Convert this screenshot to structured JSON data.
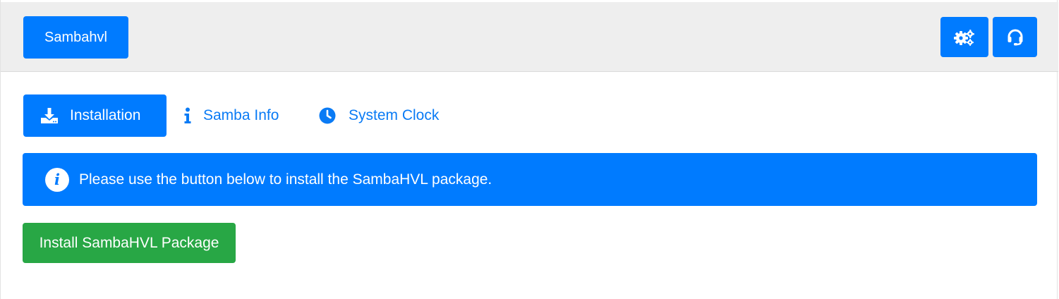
{
  "header": {
    "brand_label": "Sambahvl",
    "settings_icon": "gears-icon",
    "support_icon": "headset-icon"
  },
  "tabs": [
    {
      "label": "Installation",
      "icon": "download-icon",
      "active": true
    },
    {
      "label": "Samba Info",
      "icon": "info-icon",
      "active": false
    },
    {
      "label": "System Clock",
      "icon": "clock-icon",
      "active": false
    }
  ],
  "alert": {
    "icon": "info-circle-icon",
    "icon_glyph": "i",
    "message": "Please use the button below to install the SambaHVL package."
  },
  "install_button": {
    "label": "Install SambaHVL Package"
  },
  "colors": {
    "primary": "#007bff",
    "success": "#28a745",
    "header_bg": "#eeeeee",
    "tab_link": "#0a7bf5"
  }
}
